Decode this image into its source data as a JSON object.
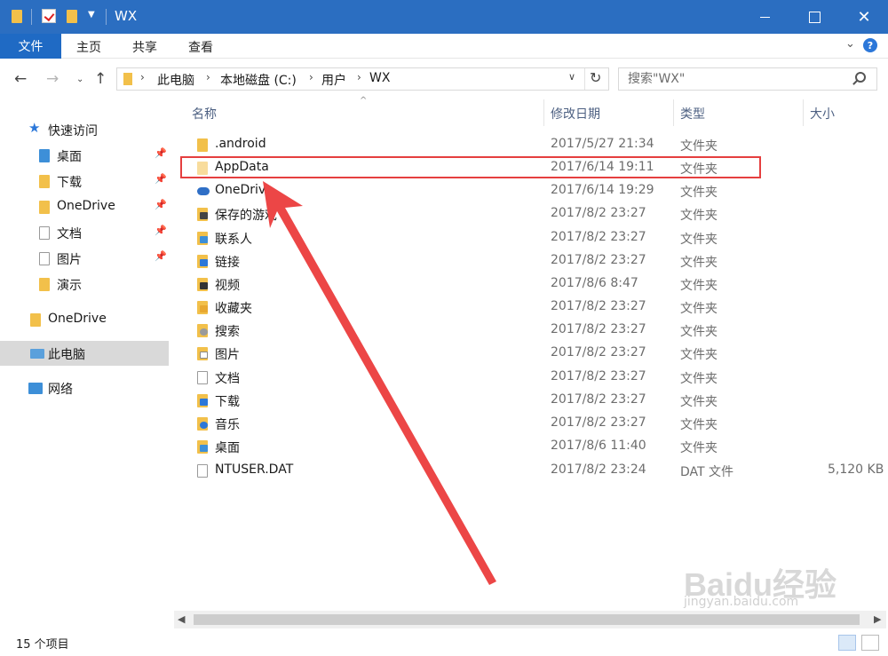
{
  "window": {
    "title": "WX"
  },
  "ribbon": {
    "file_tab": "文件",
    "tabs": [
      "主页",
      "共享",
      "查看"
    ],
    "help": "?"
  },
  "address": {
    "crumbs": [
      "此电脑",
      "本地磁盘 (C:)",
      "用户",
      "WX"
    ],
    "search_placeholder": "搜索\"WX\""
  },
  "sidebar": {
    "quick_access": "快速访问",
    "quick_items": [
      {
        "label": "桌面",
        "icon": "desktop-folder-icon"
      },
      {
        "label": "下载",
        "icon": "downloads-folder-icon"
      },
      {
        "label": "OneDrive",
        "icon": "onedrive-folder-icon"
      },
      {
        "label": "文档",
        "icon": "documents-folder-icon"
      },
      {
        "label": "图片",
        "icon": "pictures-folder-icon"
      },
      {
        "label": "演示",
        "icon": "folder-icon"
      }
    ],
    "onedrive": "OneDrive",
    "this_pc": "此电脑",
    "network": "网络"
  },
  "columns": [
    "名称",
    "修改日期",
    "类型",
    "大小"
  ],
  "files": [
    {
      "name": ".android",
      "date": "2017/5/27 21:34",
      "type": "文件夹",
      "size": "",
      "icon": "folder-icon"
    },
    {
      "name": "AppData",
      "date": "2017/6/14 19:11",
      "type": "文件夹",
      "size": "",
      "icon": "hidden-folder-icon"
    },
    {
      "name": "OneDrive",
      "date": "2017/6/14 19:29",
      "type": "文件夹",
      "size": "",
      "icon": "onedrive-folder-icon"
    },
    {
      "name": "保存的游戏",
      "date": "2017/8/2 23:27",
      "type": "文件夹",
      "size": "",
      "icon": "saved-games-folder-icon"
    },
    {
      "name": "联系人",
      "date": "2017/8/2 23:27",
      "type": "文件夹",
      "size": "",
      "icon": "contacts-folder-icon"
    },
    {
      "name": "链接",
      "date": "2017/8/2 23:27",
      "type": "文件夹",
      "size": "",
      "icon": "links-folder-icon"
    },
    {
      "name": "视频",
      "date": "2017/8/6 8:47",
      "type": "文件夹",
      "size": "",
      "icon": "videos-folder-icon"
    },
    {
      "name": "收藏夹",
      "date": "2017/8/2 23:27",
      "type": "文件夹",
      "size": "",
      "icon": "favorites-folder-icon"
    },
    {
      "name": "搜索",
      "date": "2017/8/2 23:27",
      "type": "文件夹",
      "size": "",
      "icon": "searches-folder-icon"
    },
    {
      "name": "图片",
      "date": "2017/8/2 23:27",
      "type": "文件夹",
      "size": "",
      "icon": "pictures-folder-icon"
    },
    {
      "name": "文档",
      "date": "2017/8/2 23:27",
      "type": "文件夹",
      "size": "",
      "icon": "documents-folder-icon"
    },
    {
      "name": "下载",
      "date": "2017/8/2 23:27",
      "type": "文件夹",
      "size": "",
      "icon": "downloads-folder-icon"
    },
    {
      "name": "音乐",
      "date": "2017/8/2 23:27",
      "type": "文件夹",
      "size": "",
      "icon": "music-folder-icon"
    },
    {
      "name": "桌面",
      "date": "2017/8/6 11:40",
      "type": "文件夹",
      "size": "",
      "icon": "desktop-folder-icon"
    },
    {
      "name": "NTUSER.DAT",
      "date": "2017/8/2 23:24",
      "type": "DAT 文件",
      "size": "5,120 KB",
      "icon": "file-icon"
    }
  ],
  "status": {
    "count": "15 个项目"
  },
  "watermark": {
    "brand": "Baidu经验",
    "url": "jingyan.baidu.com"
  },
  "colors": {
    "title_bar": "#2b6ec1",
    "file_tab": "#1f6ac4",
    "folder": "#f2c04a",
    "annotation": "#e53f3f"
  }
}
